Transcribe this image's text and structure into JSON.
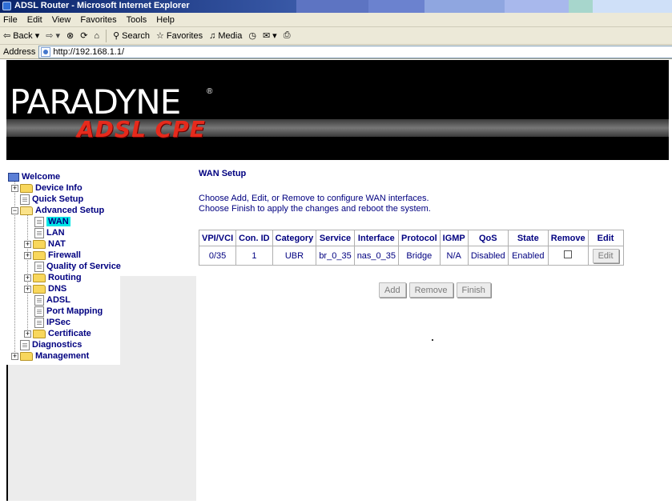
{
  "window": {
    "title": "ADSL Router - Microsoft Internet Explorer"
  },
  "menu": [
    "File",
    "Edit",
    "View",
    "Favorites",
    "Tools",
    "Help"
  ],
  "toolbar": {
    "back": "Back",
    "search": "Search",
    "favorites": "Favorites",
    "media": "Media"
  },
  "address": {
    "label": "Address",
    "url": "http://192.168.1.1/"
  },
  "banner": {
    "logo": "PARADYNE",
    "reg": "®",
    "subtitle": "ADSL CPE"
  },
  "nav": {
    "welcome": "Welcome",
    "device_info": "Device Info",
    "quick_setup": "Quick Setup",
    "advanced_setup": "Advanced Setup",
    "wan": "WAN",
    "lan": "LAN",
    "nat": "NAT",
    "firewall": "Firewall",
    "qos": "Quality of Service",
    "routing": "Routing",
    "dns": "DNS",
    "adsl": "ADSL",
    "port_mapping": "Port Mapping",
    "ipsec": "IPSec",
    "certificate": "Certificate",
    "diagnostics": "Diagnostics",
    "management": "Management"
  },
  "main": {
    "title": "WAN Setup",
    "desc_line1": "Choose Add, Edit, or Remove to configure WAN interfaces.",
    "desc_line2": "Choose Finish to apply the changes and reboot the system.",
    "table": {
      "headers": [
        "VPI/VCI",
        "Con. ID",
        "Category",
        "Service",
        "Interface",
        "Protocol",
        "IGMP",
        "QoS",
        "State",
        "Remove",
        "Edit"
      ],
      "rows": [
        {
          "vpi_vci": "0/35",
          "con_id": "1",
          "category": "UBR",
          "service": "br_0_35",
          "interface": "nas_0_35",
          "protocol": "Bridge",
          "igmp": "N/A",
          "qos": "Disabled",
          "state": "Enabled",
          "remove": false,
          "edit_label": "Edit"
        }
      ]
    },
    "buttons": {
      "add": "Add",
      "remove": "Remove",
      "finish": "Finish"
    }
  }
}
